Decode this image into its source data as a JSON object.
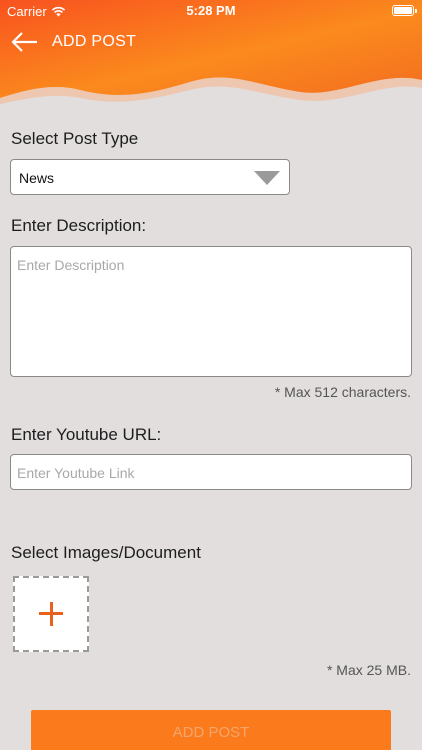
{
  "status_bar": {
    "carrier": "Carrier",
    "time": "5:28 PM",
    "wifi_icon": "wifi-icon",
    "battery_icon": "battery-icon"
  },
  "header": {
    "title": "ADD POST",
    "back_icon": "arrow-left-icon",
    "gradient_colors": [
      "#f8521f",
      "#fb8a1d",
      "#f36d20"
    ]
  },
  "form": {
    "post_type": {
      "label": "Select Post Type",
      "selected": "News",
      "caret_icon": "caret-down-icon"
    },
    "description": {
      "label": "Enter Description:",
      "value": "",
      "placeholder": "Enter Description",
      "hint": "* Max 512 characters."
    },
    "youtube": {
      "label": "Enter Youtube URL:",
      "value": "",
      "placeholder": "Enter Youtube Link"
    },
    "attachments": {
      "label": "Select Images/Document",
      "add_icon": "plus-icon",
      "hint": "* Max 25 MB."
    },
    "submit_label": "ADD POST"
  },
  "colors": {
    "accent": "#fb7a1c",
    "plus": "#e8611f",
    "background": "#e2dede"
  }
}
